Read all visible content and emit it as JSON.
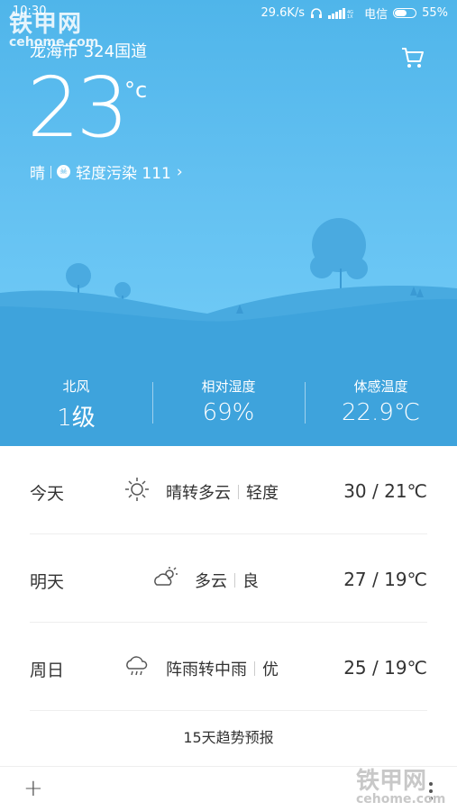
{
  "status_bar": {
    "time": "10:30",
    "net_speed": "29.6K/s",
    "carrier": "电信",
    "battery": "55%",
    "battery_level": 0.55
  },
  "watermark": {
    "brand": "铁甲网",
    "domain": "cehome.com"
  },
  "header": {
    "location": "龙海市 324国道"
  },
  "current": {
    "temperature": "23",
    "unit": "°c",
    "condition": "晴",
    "air_quality": "轻度污染 111"
  },
  "metrics": [
    {
      "label": "北风",
      "value": "1级"
    },
    {
      "label": "相对湿度",
      "value": "69%"
    },
    {
      "label": "体感温度",
      "value": "22.9℃"
    }
  ],
  "forecast": [
    {
      "day": "今天",
      "icon": "sun-icon",
      "weather": "晴转多云",
      "aqi": "轻度",
      "range": "30 / 21℃"
    },
    {
      "day": "明天",
      "icon": "partly-cloudy-icon",
      "weather": "多云",
      "aqi": "良",
      "range": "27 / 19℃"
    },
    {
      "day": "周日",
      "icon": "rain-cloud-icon",
      "weather": "阵雨转中雨",
      "aqi": "优",
      "range": "25 / 19℃"
    }
  ],
  "trend_link": "15天趋势预报",
  "colors": {
    "sky_top": "#4fb5ea",
    "sky_bottom": "#5fb9ea",
    "hill": "#3aa1dc",
    "text_dark": "#333333"
  }
}
